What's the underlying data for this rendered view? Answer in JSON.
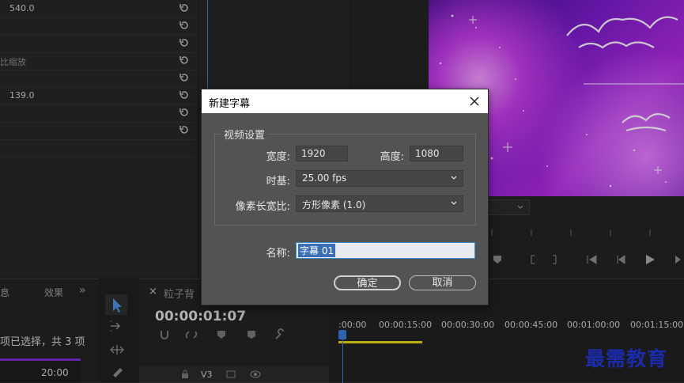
{
  "effect_controls": {
    "rows": [
      {
        "value": "540.0"
      },
      {
        "value": ""
      },
      {
        "value": ""
      },
      {
        "value": "比缩放"
      },
      {
        "value": ""
      },
      {
        "value": "139.0"
      },
      {
        "value": ""
      },
      {
        "value": ""
      }
    ]
  },
  "bottom_left": {
    "tab1": "息",
    "tab2": "效果",
    "more": "»",
    "status": "项已选择，共 3 项",
    "duration": "20:00"
  },
  "timeline": {
    "close": "×",
    "sequence_name": "粒子背",
    "timecode": "00:00:01:07",
    "track_label": "V3",
    "ruler": [
      ":00:00",
      "00:00:15:00",
      "00:00:30:00",
      "00:00:45:00",
      "00:01:00:00",
      "00:01:15:00"
    ]
  },
  "dialog": {
    "title": "新建字幕",
    "group_title": "视频设置",
    "width_label": "宽度:",
    "width_value": "1920",
    "height_label": "高度:",
    "height_value": "1080",
    "timebase_label": "时基:",
    "timebase_value": "25.00 fps",
    "pixel_aspect_label": "像素长宽比:",
    "pixel_aspect_value": "方形像素 (1.0)",
    "name_label": "名称:",
    "name_value": "字幕 01",
    "ok_label": "确定",
    "cancel_label": "取消"
  },
  "watermark": "最需教育",
  "colors": {
    "accent_blue": "#3a79d8",
    "dialog_bg": "#535353",
    "work_area_yellow": "#e6d21c",
    "watermark": "#1b2aa8"
  }
}
